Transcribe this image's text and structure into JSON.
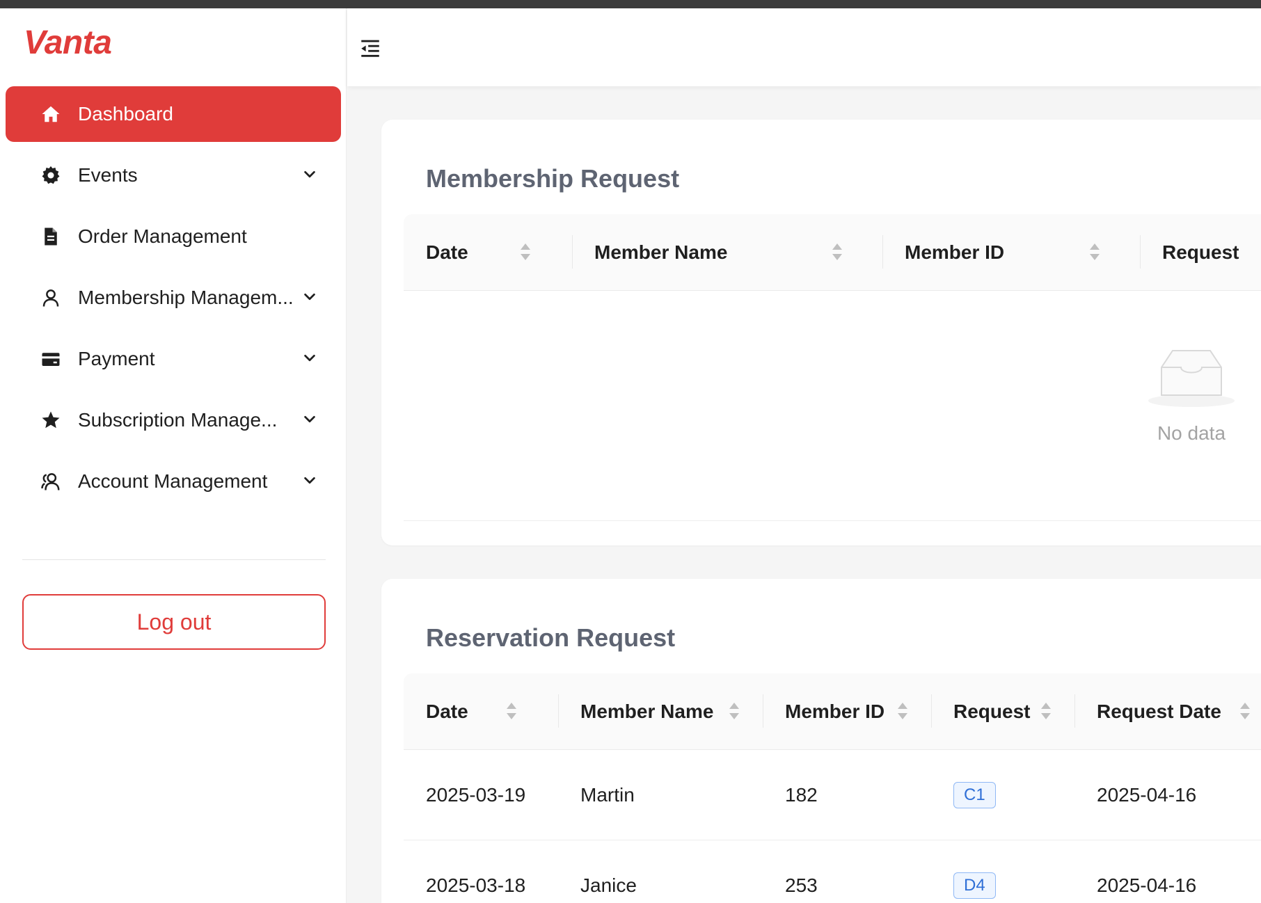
{
  "app": {
    "logo": "Vanta"
  },
  "sidebar": {
    "items": [
      {
        "label": "Dashboard",
        "icon": "home-icon",
        "active": true
      },
      {
        "label": "Events",
        "icon": "gear-icon",
        "expandable": true
      },
      {
        "label": "Order Management",
        "icon": "document-icon"
      },
      {
        "label": "Membership Managem...",
        "icon": "user-icon",
        "expandable": true
      },
      {
        "label": "Payment",
        "icon": "credit-card-icon",
        "expandable": true
      },
      {
        "label": "Subscription Manage...",
        "icon": "star-icon",
        "expandable": true
      },
      {
        "label": "Account Management",
        "icon": "team-icon",
        "expandable": true
      }
    ],
    "logout_label": "Log out"
  },
  "membership": {
    "title": "Membership Request",
    "columns": [
      "Date",
      "Member Name",
      "Member ID",
      "Request"
    ],
    "empty_text": "No data"
  },
  "reservation": {
    "title": "Reservation Request",
    "columns": [
      "Date",
      "Member Name",
      "Member ID",
      "Request",
      "Request Date"
    ],
    "rows": [
      {
        "date": "2025-03-19",
        "name": "Martin",
        "id": "182",
        "request": "C1",
        "request_date": "2025-04-16"
      },
      {
        "date": "2025-03-18",
        "name": "Janice",
        "id": "253",
        "request": "D4",
        "request_date": "2025-04-16"
      }
    ]
  },
  "colors": {
    "accent": "#e03c3a",
    "tag_blue": "#2f6fd6",
    "title_gray": "#5e6472"
  }
}
